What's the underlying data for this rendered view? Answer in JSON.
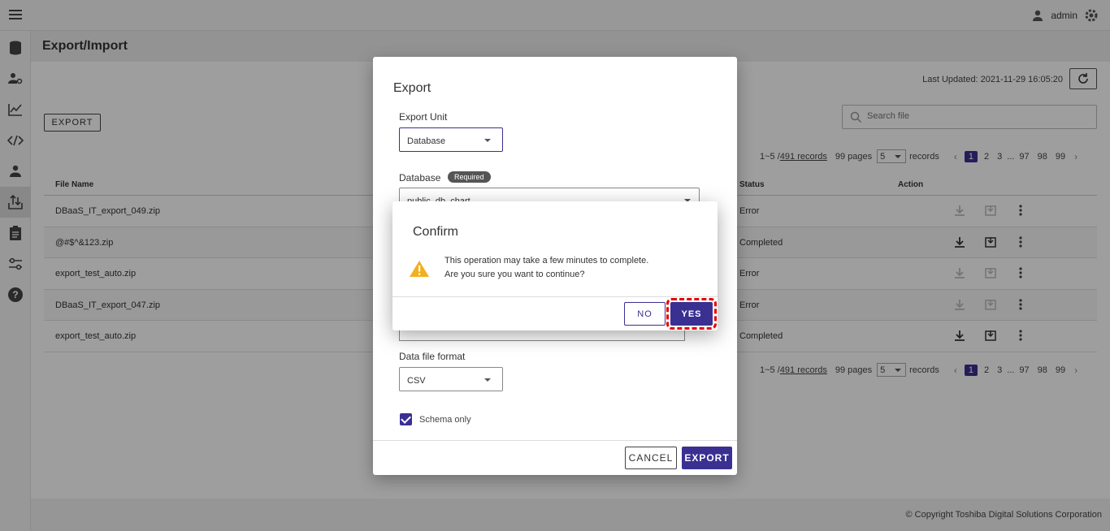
{
  "header": {
    "user": "admin"
  },
  "page": {
    "title": "Export/Import",
    "last_updated": "Last Updated: 2021-11-29 16:05:20",
    "export_label": "EXPORT",
    "search_placeholder": "Search file"
  },
  "pager": {
    "range_prefix": "1~5 / ",
    "records": "491 records",
    "pages": "99 pages",
    "per_page": "5",
    "records_label": "records",
    "pages_list": [
      "1",
      "2",
      "3",
      "...",
      "97",
      "98",
      "99"
    ]
  },
  "table": {
    "columns": {
      "file_name": "File Name",
      "status": "Status",
      "action": "Action"
    },
    "rows": [
      {
        "file": "DBaaS_IT_export_049.zip",
        "status": "Error"
      },
      {
        "file": "@#$^&123.zip",
        "status": "Completed"
      },
      {
        "file": "export_test_auto.zip",
        "status": "Error"
      },
      {
        "file": "DBaaS_IT_export_047.zip",
        "status": "Error"
      },
      {
        "file": "export_test_auto.zip",
        "status": "Completed"
      }
    ]
  },
  "export_dialog": {
    "title": "Export",
    "unit_label": "Export Unit",
    "unit_value": "Database",
    "database_label": "Database",
    "required": "Required",
    "database_value": "public_db_chart",
    "format_label": "Data file format",
    "format_value": "CSV",
    "schema_only": "Schema only",
    "cancel": "CANCEL",
    "export": "EXPORT"
  },
  "confirm_dialog": {
    "title": "Confirm",
    "message_line1": "This operation may take a few minutes to complete.",
    "message_line2": "Are you sure you want to continue?",
    "no": "NO",
    "yes": "YES"
  },
  "footer": {
    "copyright": "© Copyright Toshiba Digital Solutions Corporation"
  },
  "colors": {
    "primary": "#3a3092",
    "warning": "#f2b01e",
    "highlight": "#e60000"
  }
}
